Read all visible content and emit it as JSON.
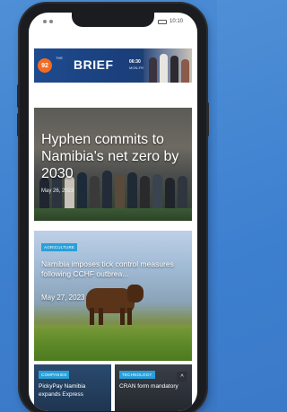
{
  "status_bar": {
    "time": "10:10",
    "battery_label": ""
  },
  "banner": {
    "logo_text": "92",
    "kicker": "THE",
    "title": "BRIEF",
    "time": "06:30",
    "days": "MON-FRI"
  },
  "hero": {
    "title": "Hyphen commits to Namibia's net zero by 2030",
    "date": "May 26, 2023"
  },
  "agri": {
    "tag": "AGRICULTURE",
    "title": "Namibia imposes tick control measures following CCHF outbrea...",
    "date": "May 27, 2023"
  },
  "companies": {
    "tag": "COMPANIES",
    "title": "PickyPay Namibia expands Express"
  },
  "tech": {
    "tag": "TECHNOLOGY",
    "title": "CRAN form mandatory"
  },
  "scroll_top_icon": "^",
  "colors": {
    "background": "#3d7fcf",
    "tag": "#2a9fd8",
    "logo": "#f26c23",
    "banner": "#1e4b8f"
  }
}
